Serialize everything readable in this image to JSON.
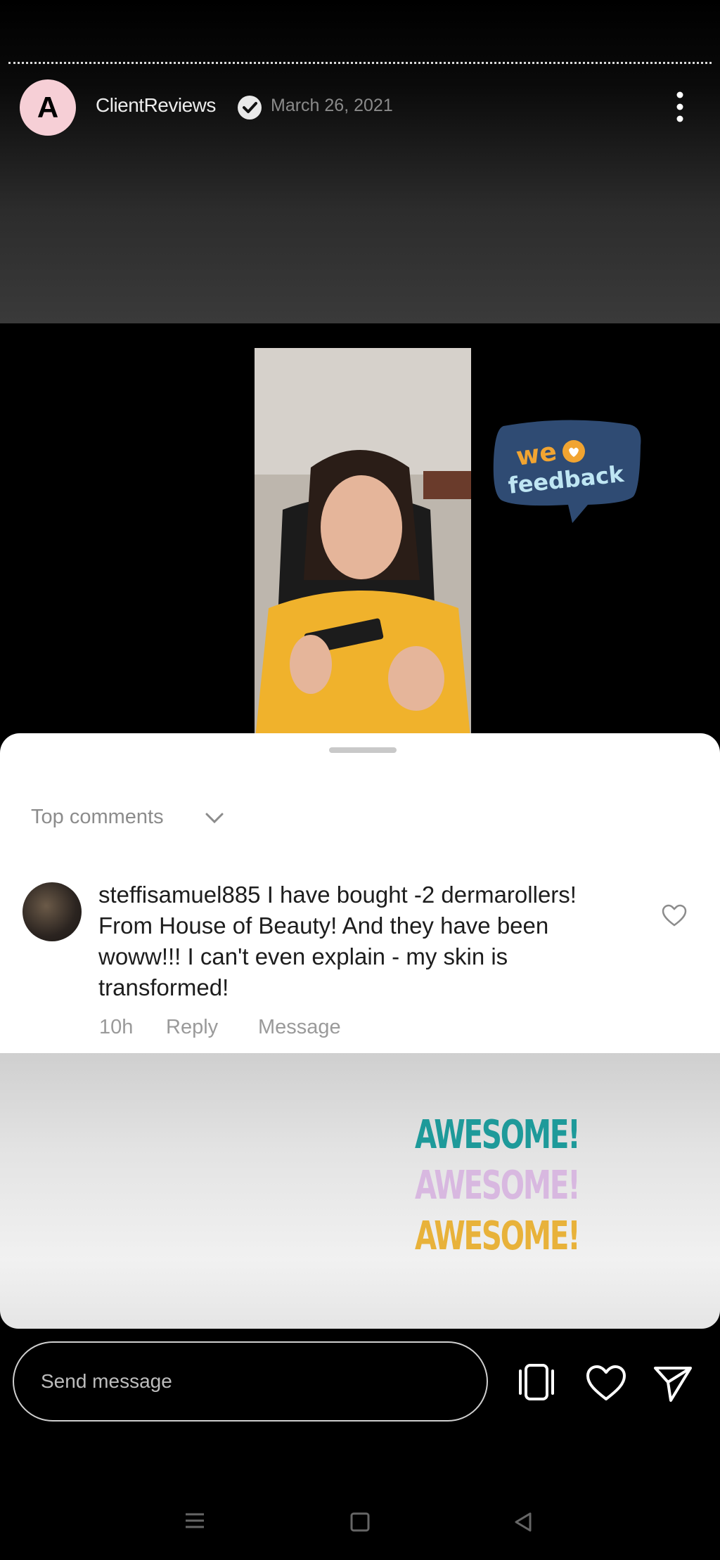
{
  "header": {
    "avatar_letter": "A",
    "username": "ClientReviews",
    "verified_icon": "verified-badge-icon",
    "date": "March 26, 2021",
    "menu_icon": "more-vertical-icon"
  },
  "sticker": {
    "line1": "we",
    "line2": "feedback",
    "heart_icon": "heart-icon"
  },
  "comments_sheet": {
    "sort_label": "Top comments",
    "comment": {
      "username": "steffisamuel885",
      "text": "I have bought -2 dermarollers! From House of Beauty! And they have been woww!!! I can't even explain - my skin is transformed!",
      "time": "10h",
      "reply_label": "Reply",
      "message_label": "Message"
    }
  },
  "overlay_text": [
    "AWESOME!",
    "AWESOME!",
    "AWESOME!"
  ],
  "overlay_colors": [
    "#1e9a9a",
    "#d8b8e0",
    "#e8b23a"
  ],
  "footer": {
    "message_placeholder": "Send message",
    "icons": [
      "gallery-icon",
      "heart-icon",
      "send-icon"
    ]
  },
  "system_nav": [
    "menu-icon",
    "home-icon",
    "back-icon"
  ]
}
